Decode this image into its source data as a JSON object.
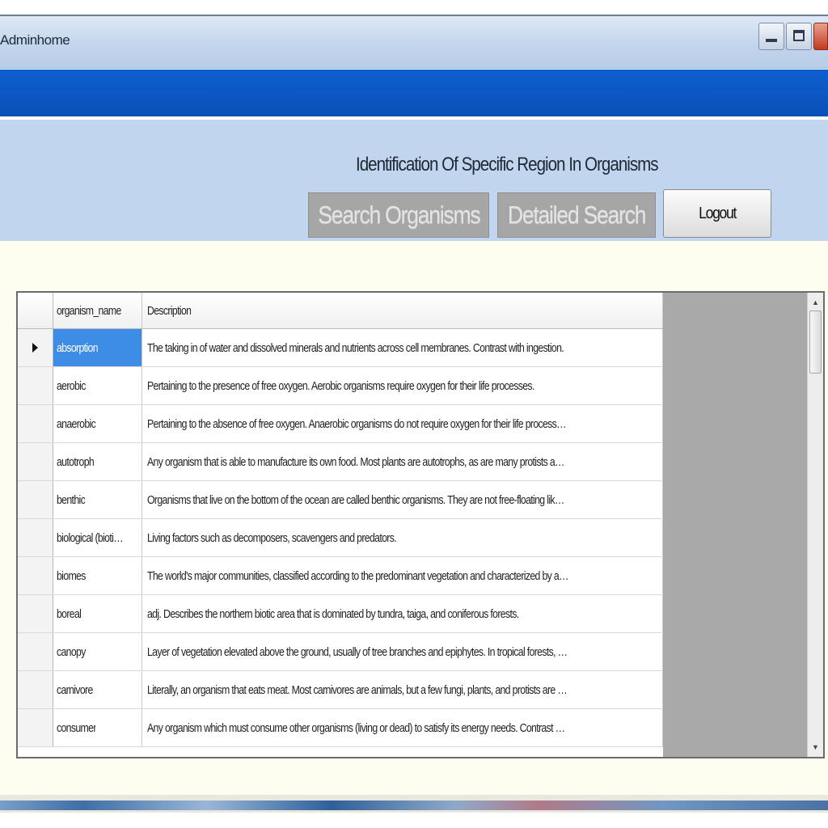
{
  "window": {
    "title": "Adminhome"
  },
  "header": {
    "heading": "Identification Of Specific Region In Organisms",
    "buttons": {
      "search_organisms": "Search Organisms",
      "detailed_search": "Detailed Search",
      "logout": "Logout"
    }
  },
  "grid": {
    "columns": [
      "organism_name",
      "Description"
    ],
    "rows": [
      {
        "organism_name": "absorption",
        "description": "The taking in of water and dissolved minerals and nutrients across cell membranes. Contrast with ingestion.",
        "selected": true
      },
      {
        "organism_name": "aerobic",
        "description": "Pertaining to the presence of free oxygen. Aerobic organisms require oxygen for their life processes."
      },
      {
        "organism_name": "anaerobic",
        "description": "Pertaining to the absence of free oxygen. Anaerobic organisms do not require oxygen for their life processes, in fact oxyg..."
      },
      {
        "organism_name": "autotroph",
        "description": "Any organism that is able to manufacture its own food. Most plants are autotrophs, as are many protists and bacteria. Con..."
      },
      {
        "organism_name": "benthic",
        "description": "Organisms that live on the bottom of the ocean are called benthic organisms. They are not free-floating like pelagic organ..."
      },
      {
        "organism_name": "biological (biotic f...",
        "description": "Living factors such as decomposers, scavengers and predators."
      },
      {
        "organism_name": "biomes",
        "description": "The world's major communities, classified according to the predominant vegetation and characterized by adaptations of o..."
      },
      {
        "organism_name": "boreal",
        "description": "adj. Describes the northern biotic area that is dominated by tundra, taiga, and coniferous forests."
      },
      {
        "organism_name": "canopy",
        "description": "Layer of vegetation elevated above the ground, usually of tree branches and epiphytes. In tropical forests, the canopy ma..."
      },
      {
        "organism_name": "carnivore",
        "description": "Literally, an organism that eats meat. Most carnivores are animals, but a few fungi, plants, and protists are as well."
      },
      {
        "organism_name": "consumer",
        "description": "Any organism which must consume other organisms (living or dead) to satisfy its energy needs. Contrast with autotroph."
      }
    ]
  }
}
